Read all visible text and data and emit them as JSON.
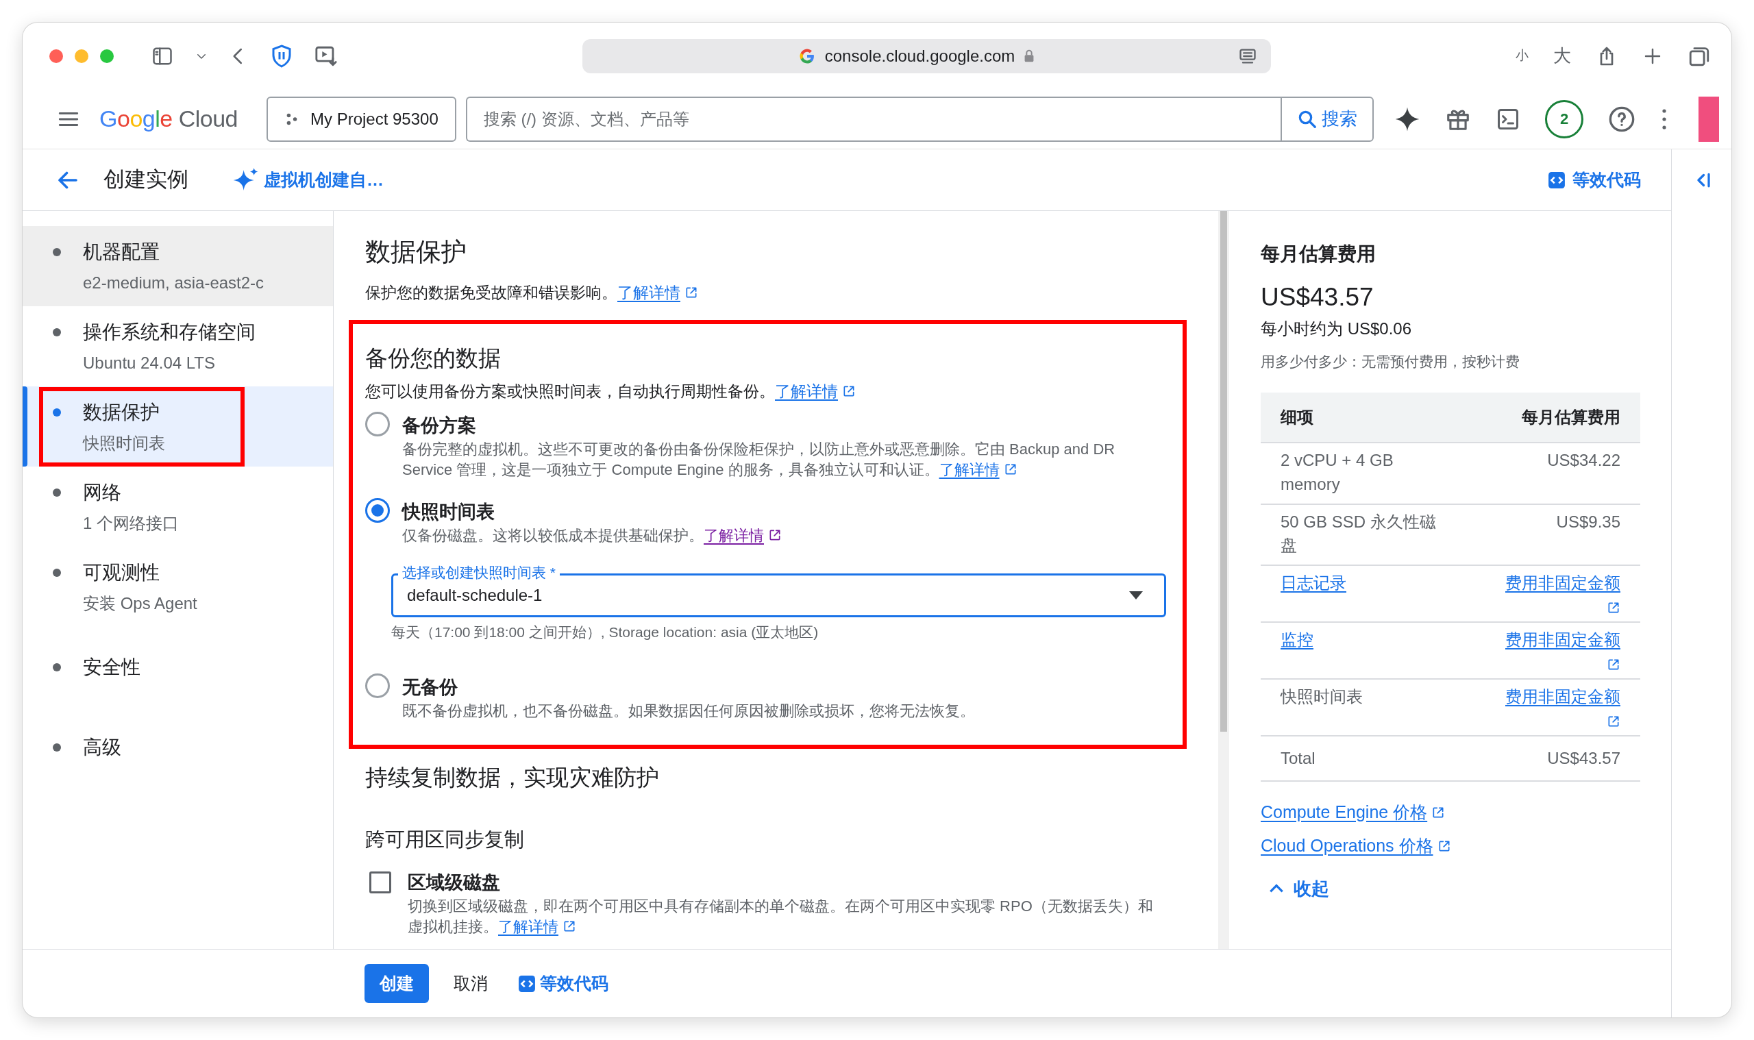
{
  "browser": {
    "url": "console.cloud.google.com",
    "zoom_out": "小",
    "zoom_in": "大"
  },
  "header": {
    "logo": [
      "Google",
      "Cloud"
    ],
    "project": "My Project 95300",
    "search_placeholder": "搜索 (/) 资源、文档、产品等",
    "search_button": "搜索",
    "badge": "2"
  },
  "page_bar": {
    "title": "创建实例",
    "assist_link": "虚拟机创建自…",
    "code_link": "等效代码"
  },
  "sidebar": {
    "items": [
      {
        "title": "机器配置",
        "subtitle": "e2-medium, asia-east2-c",
        "selected": false,
        "hovered": true,
        "highlighted": false
      },
      {
        "title": "操作系统和存储空间",
        "subtitle": "Ubuntu 24.04 LTS",
        "selected": false,
        "hovered": false,
        "highlighted": false
      },
      {
        "title": "数据保护",
        "subtitle": "快照时间表",
        "selected": true,
        "hovered": false,
        "highlighted": true
      },
      {
        "title": "网络",
        "subtitle": "1 个网络接口",
        "selected": false,
        "hovered": false,
        "highlighted": false
      },
      {
        "title": "可观测性",
        "subtitle": "安装 Ops Agent",
        "selected": false,
        "hovered": false,
        "highlighted": false
      },
      {
        "title": "安全性",
        "selected": false,
        "hovered": false,
        "highlighted": false
      },
      {
        "title": "高级",
        "selected": false,
        "hovered": false,
        "highlighted": false
      }
    ]
  },
  "main": {
    "title": "数据保护",
    "intro": "保护您的数据免受故障和错误影响。",
    "intro_link": {
      "text": "了解详情",
      "visited": false
    },
    "backup": {
      "highlighted": true,
      "title": "备份您的数据",
      "description": "您可以使用备份方案或快照时间表，自动执行周期性备份。",
      "link": {
        "text": "了解详情",
        "visited": false
      },
      "options": [
        {
          "label": "备份方案",
          "selected": false,
          "description": "备份完整的虚拟机。这些不可更改的备份由备份保险柜保护，以防止意外或恶意删除。它由 Backup and DR Service 管理，这是一项独立于 Compute Engine 的服务，具备独立认可和认证。",
          "link": {
            "text": "了解详情",
            "visited": false
          }
        },
        {
          "label": "快照时间表",
          "selected": true,
          "description": "仅备份磁盘。这将以较低成本提供基础保护。",
          "link": {
            "text": "了解详情",
            "visited": true
          },
          "select": {
            "label": "选择或创建快照时间表 *",
            "value": "default-schedule-1",
            "hint": "每天（17:00 到18:00 之间开始）, Storage location: asia (亚太地区)"
          }
        },
        {
          "label": "无备份",
          "selected": false,
          "description": "既不备份虚拟机，也不备份磁盘。如果数据因任何原因被删除或损坏，您将无法恢复。"
        }
      ]
    },
    "replication": {
      "title": "持续复制数据，实现灾难防护",
      "subtitle": "跨可用区同步复制",
      "options": [
        {
          "label": "区域级磁盘",
          "checked": false,
          "description": "切换到区域级磁盘，即在两个可用区中具有存储副本的单个磁盘。在两个可用区中实现零 RPO（无数据丢失）和虚拟机挂接。",
          "link": {
            "text": "了解详情",
            "visited": false
          }
        }
      ]
    }
  },
  "footer": {
    "create": "创建",
    "cancel": "取消",
    "code": "等效代码"
  },
  "cost": {
    "title": "每月估算费用",
    "total": "US$43.57",
    "hourly": "每小时约为 US$0.06",
    "note": "用多少付多少：无需预付费用，按秒计费",
    "columns": [
      "细项",
      "每月估算费用"
    ],
    "rows": [
      {
        "item": "2 vCPU + 4 GB memory",
        "cost": "US$34.22",
        "item_link": false,
        "cost_link": false
      },
      {
        "item": "50 GB SSD 永久性磁盘",
        "cost": "US$9.35",
        "item_link": false,
        "cost_link": false
      },
      {
        "item": "日志记录",
        "cost": "费用非固定金额",
        "item_link": true,
        "cost_link": true
      },
      {
        "item": "监控",
        "cost": "费用非固定金额",
        "item_link": true,
        "cost_link": true
      },
      {
        "item": "快照时间表",
        "cost": "费用非固定金额",
        "item_link": false,
        "cost_link": true
      }
    ],
    "total_row": {
      "label": "Total",
      "value": "US$43.57"
    },
    "links": [
      "Compute Engine 价格",
      "Cloud Operations 价格"
    ],
    "collapse": "收起"
  }
}
